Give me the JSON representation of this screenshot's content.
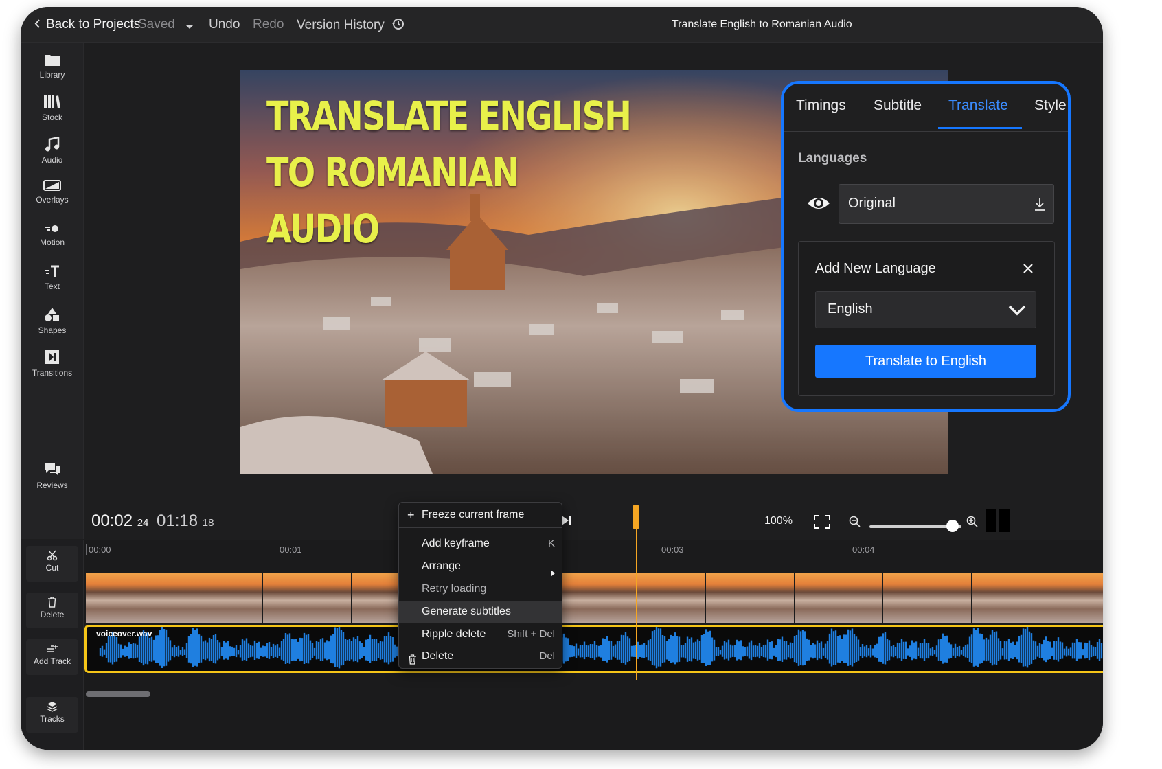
{
  "topbar": {
    "back": "Back to Projects",
    "saved": "Saved",
    "undo": "Undo",
    "redo": "Redo",
    "version_history": "Version History",
    "project_title": "Translate English to Romanian Audio"
  },
  "sidebar": {
    "items": [
      {
        "label": "Library",
        "icon": "folder-icon"
      },
      {
        "label": "Stock",
        "icon": "books-icon"
      },
      {
        "label": "Audio",
        "icon": "music-note-icon"
      },
      {
        "label": "Overlays",
        "icon": "overlay-icon"
      },
      {
        "label": "Motion",
        "icon": "motion-icon"
      },
      {
        "label": "Text",
        "icon": "text-icon"
      },
      {
        "label": "Shapes",
        "icon": "shapes-icon"
      },
      {
        "label": "Transitions",
        "icon": "transitions-icon"
      }
    ],
    "reviews": "Reviews"
  },
  "preview": {
    "title_lines": [
      "TRANSLATE ENGLISH",
      "TO ROMANIAN",
      "AUDIO"
    ]
  },
  "playback": {
    "current_time": "00:02",
    "current_frame": "24",
    "total_time": "01:18",
    "total_frame": "18",
    "zoom": "100%",
    "zoom_slider_fraction": 0.9
  },
  "timeline": {
    "tools": [
      "Cut",
      "Delete",
      "Add Track",
      "Tracks"
    ],
    "ruler": [
      "00:00",
      "00:01",
      "00:03",
      "00:04"
    ],
    "audio_clip": "voiceover.wav"
  },
  "context_menu": {
    "freeze": "Freeze current frame",
    "items": [
      {
        "label": "Add keyframe",
        "shortcut": "K"
      },
      {
        "label": "Arrange",
        "shortcut": ""
      },
      {
        "label": "Retry loading",
        "shortcut": ""
      },
      {
        "label": "Generate subtitles",
        "shortcut": ""
      },
      {
        "label": "Ripple delete",
        "shortcut": "Shift + Del"
      },
      {
        "label": "Delete",
        "shortcut": "Del"
      }
    ]
  },
  "panel": {
    "tabs": [
      "Timings",
      "Subtitle",
      "Translate",
      "Style"
    ],
    "active_tab": "Translate",
    "languages_heading": "Languages",
    "original_value": "Original",
    "add_title": "Add New Language",
    "selected_language": "English",
    "translate_button": "Translate to English",
    "accent_color": "#1677ff"
  }
}
